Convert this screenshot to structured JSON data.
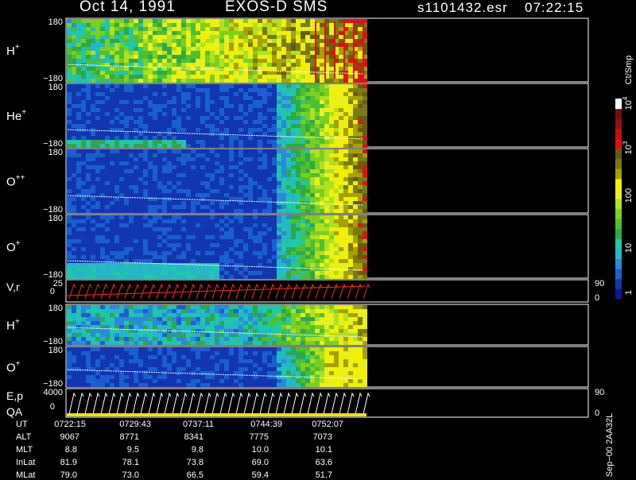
{
  "header": {
    "title": "Oct 14, 1991",
    "instrument": "EXOS-D SMS",
    "file": "s1101432.esr",
    "time": "07:22:15"
  },
  "panels": [
    {
      "id": "h-plus-1",
      "label": "H",
      "sup": "+",
      "ytop": "180",
      "ybot": "−180",
      "type": "spectrogram"
    },
    {
      "id": "he-plus",
      "label": "He",
      "sup": "+",
      "ytop": "180",
      "ybot": "−180",
      "type": "spectrogram"
    },
    {
      "id": "o-plus-plus",
      "label": "O",
      "sup": "++",
      "ytop": "180",
      "ybot": "−180",
      "type": "spectrogram"
    },
    {
      "id": "o-plus-1",
      "label": "O",
      "sup": "+",
      "ytop": "180",
      "ybot": "−180",
      "type": "spectrogram"
    },
    {
      "id": "v-r",
      "label": "V,r",
      "sup": "",
      "ytop": "25",
      "ybot": "0",
      "rtop": "90",
      "rbot": "0",
      "type": "line"
    },
    {
      "id": "h-plus-2",
      "label": "H",
      "sup": "+",
      "ytop": "180",
      "ybot": "−180",
      "type": "spectrogram"
    },
    {
      "id": "o-plus-2",
      "label": "O",
      "sup": "+",
      "ytop": "180",
      "ybot": "−180",
      "type": "spectrogram"
    },
    {
      "id": "e-p-qa",
      "label": "E,p",
      "label2": "QA",
      "sup": "",
      "ytop": "4000",
      "ybot": "0",
      "rtop": "90",
      "rbot": "0",
      "type": "line"
    }
  ],
  "colorbar": {
    "unit": "Ct/Smp",
    "ticks": [
      "1",
      "10",
      "100",
      "10",
      "10"
    ],
    "tick_sup": [
      "",
      "",
      "",
      "3",
      "4"
    ],
    "colors": [
      "#0c1a8c",
      "#1236b0",
      "#1a5fd0",
      "#2a8ad8",
      "#22b8c8",
      "#1fc8a8",
      "#2ea84a",
      "#4cc030",
      "#7ad020",
      "#b0e020",
      "#e8f020",
      "#f0f000",
      "#a8a000",
      "#7a7a10",
      "#6a5a10",
      "#e01010",
      "#c01010",
      "#901010",
      "#701010",
      "#ffffff"
    ]
  },
  "footer": {
    "stamp": "Sep−00  2AA32L"
  },
  "ephemeris": {
    "rows": [
      {
        "label": "UT",
        "values": [
          "0722:15",
          "0729:43",
          "0737:11",
          "0744:39",
          "0752:07"
        ]
      },
      {
        "label": "ALT",
        "values": [
          "9067",
          "8771",
          "8341",
          "7775",
          "7073"
        ]
      },
      {
        "label": "MLT",
        "values": [
          "8.8",
          "9.5",
          "9.8",
          "10.0",
          "10.1"
        ]
      },
      {
        "label": "InLat",
        "values": [
          "81.9",
          "78.1",
          "73.8",
          "69.0",
          "63.6"
        ]
      },
      {
        "label": "MLat",
        "values": [
          "79.0",
          "73.0",
          "66.5",
          "59.4",
          "51.7"
        ]
      }
    ]
  }
}
